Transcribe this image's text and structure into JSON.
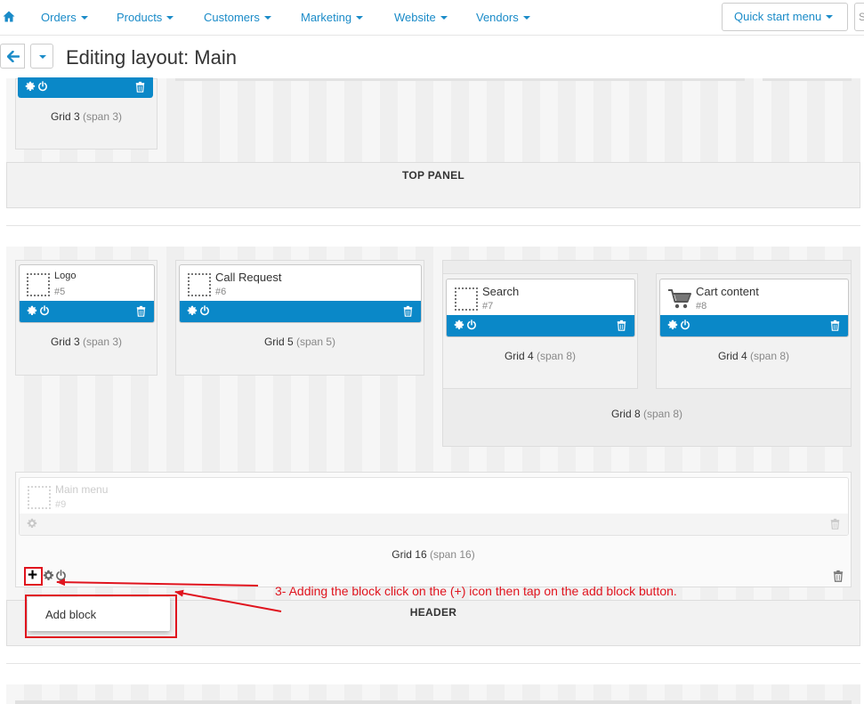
{
  "topnav": {
    "home_icon": "home-icon",
    "items": [
      {
        "label": "Orders"
      },
      {
        "label": "Products"
      },
      {
        "label": "Customers"
      },
      {
        "label": "Marketing"
      },
      {
        "label": "Website"
      },
      {
        "label": "Vendors"
      }
    ],
    "quick_start": "Quick start menu",
    "search_stub": "S"
  },
  "titlebar": {
    "back_icon": "arrow-left-icon",
    "title": "Editing layout: Main"
  },
  "colors": {
    "accent": "#0a88c8",
    "link": "#1a8bc8",
    "annotation": "#e0141e"
  },
  "top_section": {
    "grid_label": "Grid 3",
    "grid_span": "(span 3)",
    "panel_label": "TOP PANEL"
  },
  "header_section": {
    "blocks": [
      {
        "name": "Logo",
        "id": "#5",
        "icon": "placeholder-icon"
      },
      {
        "name": "Call Request",
        "id": "#6",
        "icon": "placeholder-icon"
      },
      {
        "name": "Search",
        "id": "#7",
        "icon": "placeholder-icon"
      },
      {
        "name": "Cart content",
        "id": "#8",
        "icon": "cart-icon"
      },
      {
        "name": "Main menu",
        "id": "#9",
        "icon": "placeholder-icon",
        "disabled": true
      }
    ],
    "grids": [
      {
        "label": "Grid 3",
        "span": "(span 3)"
      },
      {
        "label": "Grid 5",
        "span": "(span 5)"
      },
      {
        "label": "Grid 4",
        "span": "(span 8)"
      },
      {
        "label": "Grid 4",
        "span": "(span 8)"
      },
      {
        "label": "Grid 8",
        "span": "(span 8)"
      },
      {
        "label": "Grid 16",
        "span": "(span 16)"
      }
    ],
    "panel_label": "HEADER"
  },
  "annotation": {
    "text": "3- Adding the block click on the (+) icon then tap on the add block button.",
    "plus": "+",
    "add_block": "Add block"
  }
}
